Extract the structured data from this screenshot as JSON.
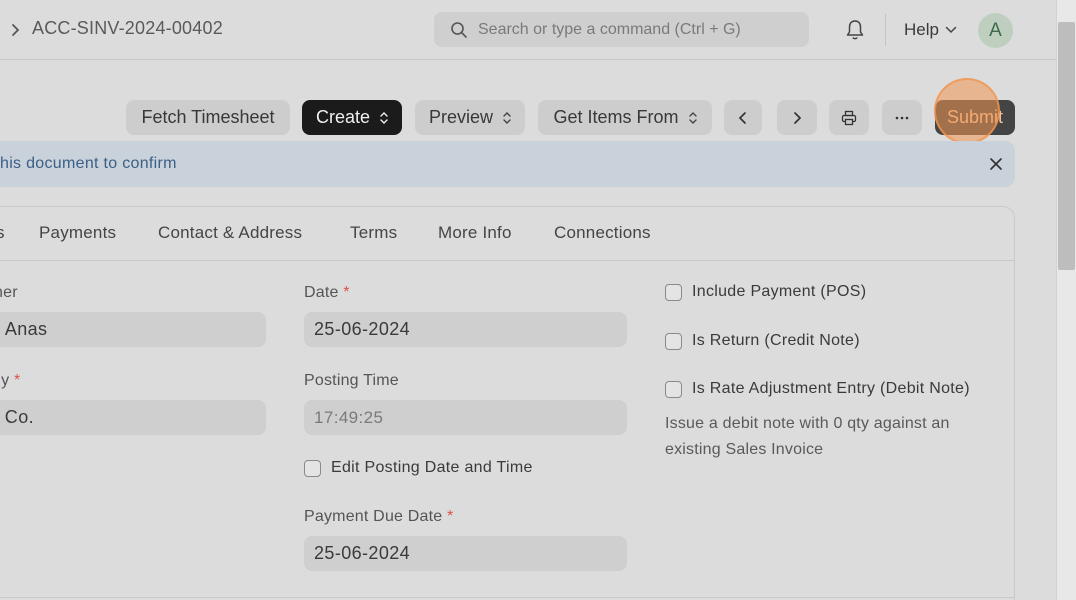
{
  "navbar": {
    "breadcrumb": "ACC-SINV-2024-00402",
    "search_placeholder": "Search or type a command (Ctrl + G)",
    "help_label": "Help",
    "avatar_initial": "A"
  },
  "toolbar": {
    "fetch_timesheet": "Fetch Timesheet",
    "create": "Create",
    "preview": "Preview",
    "get_items_from": "Get Items From",
    "submit": "Submit"
  },
  "alert": {
    "text": "his document to confirm"
  },
  "tabs": [
    {
      "label": "s"
    },
    {
      "label": "Payments"
    },
    {
      "label": "Contact & Address"
    },
    {
      "label": "Terms"
    },
    {
      "label": "More Info"
    },
    {
      "label": "Connections"
    }
  ],
  "form": {
    "customer_label": "ner",
    "customer_value": "n Anas",
    "company_label": "ny",
    "company_value": "k Co.",
    "date_label": "Date",
    "date_value": "25-06-2024",
    "posting_time_label": "Posting Time",
    "posting_time_value": "17:49:25",
    "edit_posting_label": "Edit Posting Date and Time",
    "payment_due_label": "Payment Due Date",
    "payment_due_value": "25-06-2024",
    "include_payment_label": "Include Payment (POS)",
    "is_return_label": "Is Return (Credit Note)",
    "rate_adjustment_label": "Is Rate Adjustment Entry (Debit Note)",
    "rate_adjustment_help": "Issue a debit note with 0 qty against an existing Sales Invoice",
    "required_mark": "*"
  },
  "colors": {
    "create_bg": "#1b1b1b",
    "submit_text": "#f6c49d",
    "alert_bg": "#c9d2da",
    "required": "#d9534f"
  }
}
